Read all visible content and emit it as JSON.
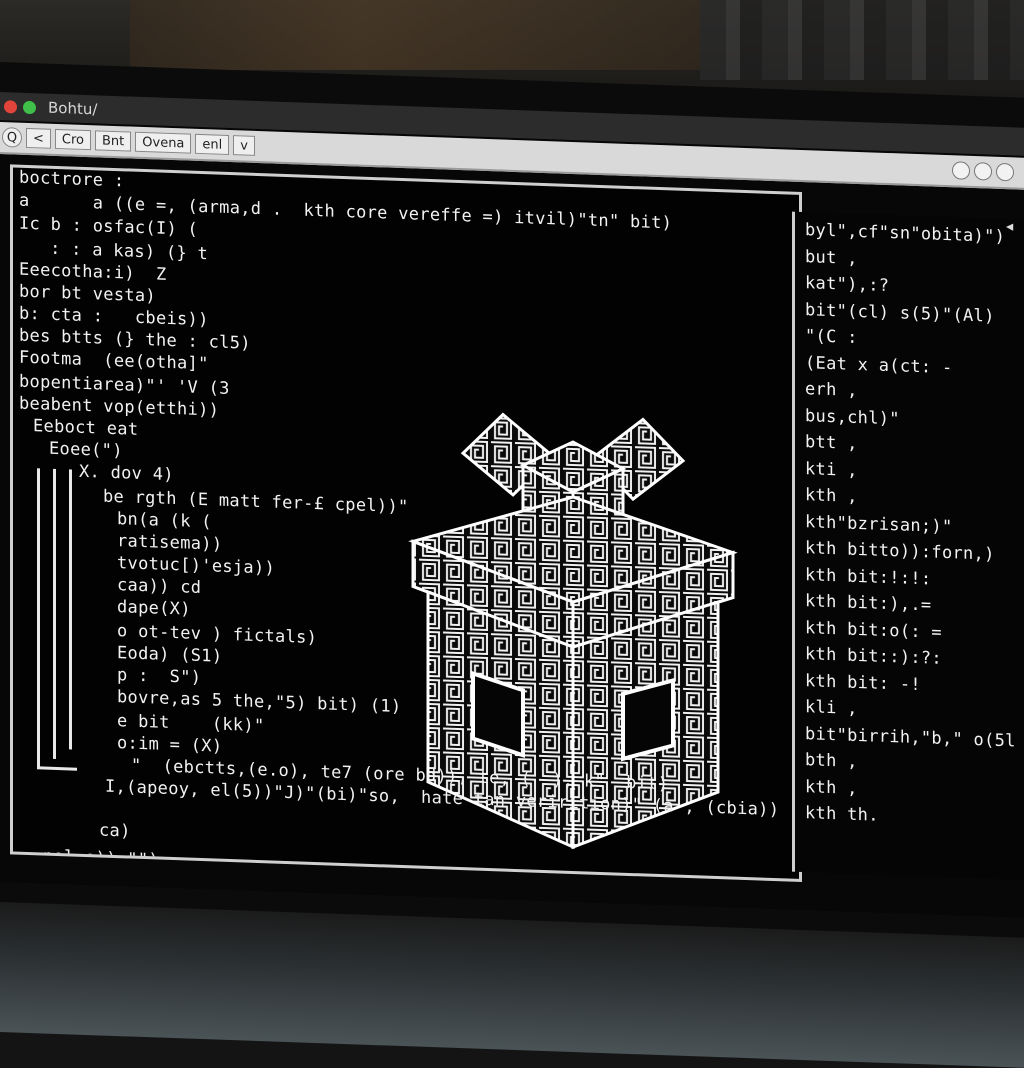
{
  "window": {
    "title": "Bohtu/",
    "toolbar": [
      "Q",
      "<",
      "Cro",
      "Bnt",
      "Ovena",
      "enl",
      "v"
    ]
  },
  "code_lines": [
    "boctrore :",
    "a      a ((e =, (arma,d .  kth core vereffe =) itvil)\"tn\" bit)",
    "Ic b : osfac(I) (",
    "  : : a kas) (} t",
    "Eeecotha:i)  Z",
    "bor bt vesta)",
    "b: cta :   cbeis))",
    "bes btts (} the : cl5)",
    "Footma  (ee(otha]\"",
    "bopentiarea)\"' 'V (3",
    "beabent vop(etthi))",
    "Eeboct eat",
    "Eoee(\")",
    "X. dov 4)",
    "be rgth (E matt fer-£ cpel))\"",
    "bn(a (k (",
    "ratisema))",
    "tvotuc[)'esja))",
    "caa)) cd",
    "dape(X)",
    "o ot-tev ) fictals)",
    "Eoda) (S1)",
    "p :  S\")",
    "bovre,as 5 the,\"5) bit) (1)",
    "e bit    (kk)\"",
    "o:im = (X)",
    "\"  (ebctts,(e.o), te7 (ore bd)), te, (  ), k\"  bit)",
    "I,(apeoy, el(5))\"J)\"(bi)\"so,  hate tan verirition)\" (a , (cbia))",
    "ca)",
    "pol o)),\"\")"
  ],
  "right_lines": [
    "byl\",cf\"sn\"obita)\")",
    "but ,",
    "kat\"),:?",
    "bit\"(cl) s(5)\"(Al)",
    "\"(C :",
    "(Eat x a(ct: -",
    "erh ,",
    "bus,chl)\"",
    "btt ,",
    "kti ,",
    "kth ,",
    "kth\"bzrisan;)\"",
    "kth bitto)):forn,)",
    "kth bit:!:!:",
    "kth bit:),.=",
    "kth bit:o(: =",
    "kth bit::):?:",
    "kth bit: -!",
    "kli ,",
    "bit\"birrih,\"b,\" o(5l",
    "bth ,",
    "kth ,",
    "kth th."
  ]
}
